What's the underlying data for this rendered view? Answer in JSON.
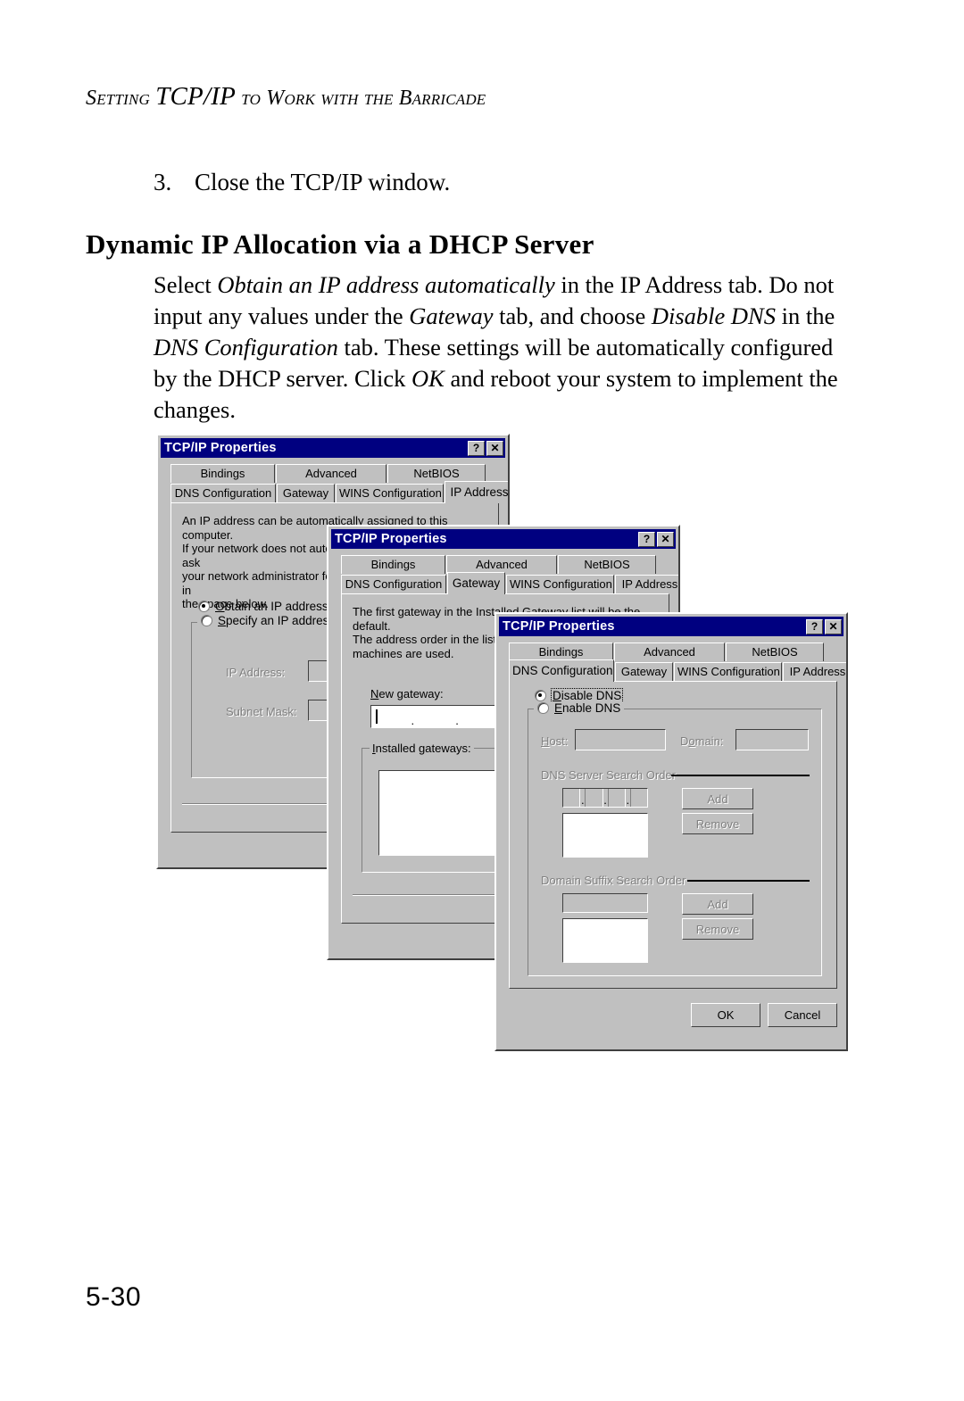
{
  "page": {
    "running_head": "Setting TCP/IP to Work with the Barricade",
    "page_number": "5-30"
  },
  "step": {
    "number": "3.",
    "text": "Close the TCP/IP window."
  },
  "section": {
    "heading": "Dynamic IP Allocation via a DHCP Server"
  },
  "paragraph": {
    "p1": "Select ",
    "i1": "Obtain an IP address automatically",
    "p2": " in the IP Address tab. Do not input any values under the ",
    "i2": "Gateway",
    "p3": " tab, and choose ",
    "i3": "Disable DNS",
    "p4": " in the ",
    "i4": "DNS Configuration",
    "p5": " tab. These settings will be automatically configured by the DHCP server. Click ",
    "i5": "OK",
    "p6": " and reboot your system to implement the changes."
  },
  "dialogs": {
    "common": {
      "title": "TCP/IP Properties",
      "help_btn": "?",
      "close_btn": "✕",
      "tabs_top": [
        "Bindings",
        "Advanced",
        "NetBIOS"
      ],
      "tabs_bottom": [
        "DNS Configuration",
        "Gateway",
        "WINS Configuration",
        "IP Address"
      ]
    },
    "ip_address": {
      "selected_tab": "IP Address",
      "description": "An IP address can be automatically assigned to this computer.\nIf your network does not automatically assign IP addresses, ask\nyour network administrator for an address, and then type it in\nthe space below.",
      "radio_obtain": "Obtain an IP address automatically",
      "radio_obtain_selected": true,
      "radio_specify": "Specify an IP address:",
      "radio_specify_selected": false,
      "label_ip_address": "IP Address:",
      "label_subnet_mask": "Subnet Mask:"
    },
    "gateway": {
      "selected_tab": "Gateway",
      "description": "The first gateway in the Installed Gateway list will be the default.\nThe address order in the list will be the order in which these\nmachines are used.",
      "label_new_gateway": "New gateway:",
      "new_gateway_value": "",
      "label_installed_gateways": "Installed gateways:",
      "installed_gateways": []
    },
    "dns": {
      "selected_tab": "DNS Configuration",
      "radio_disable": "Disable DNS",
      "radio_disable_selected": true,
      "radio_enable": "Enable DNS",
      "radio_enable_selected": false,
      "label_host": "Host:",
      "host_value": "",
      "label_domain": "Domain:",
      "domain_value": "",
      "group_dns_search": "DNS Server Search Order",
      "dns_search_value": "",
      "dns_search_list": [],
      "btn_add_dns": "Add",
      "btn_remove_dns": "Remove",
      "group_suffix_search": "Domain Suffix Search Order",
      "suffix_value": "",
      "suffix_list": [],
      "btn_add_suffix": "Add",
      "btn_remove_suffix": "Remove",
      "btn_ok": "OK",
      "btn_cancel": "Cancel"
    }
  },
  "colors": {
    "titlebar": "#000080",
    "dialog_face": "#c0c0c0",
    "disabled_text": "#808080"
  }
}
